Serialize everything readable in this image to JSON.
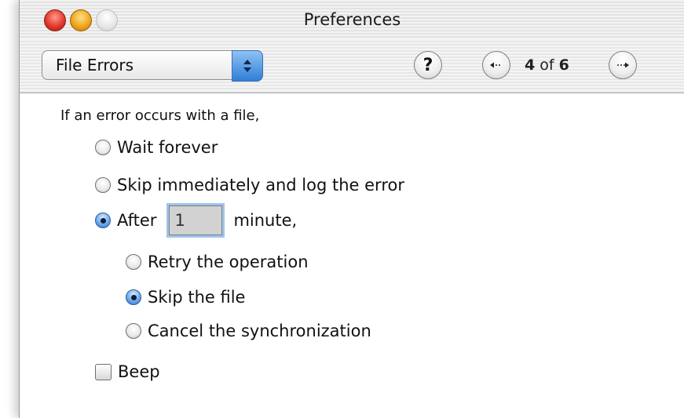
{
  "window": {
    "title": "Preferences"
  },
  "toolbar": {
    "popup_label": "File Errors",
    "help_label": "?",
    "page_current": "4",
    "page_of": "of",
    "page_total": "6"
  },
  "content": {
    "intro": "If an error occurs with a file,",
    "options": {
      "wait_forever": "Wait forever",
      "skip_log": "Skip immediately and log the error",
      "after": "After",
      "after_minutes_value": "1",
      "minute": "minute,"
    },
    "sub_options": {
      "retry": "Retry the operation",
      "skip_file": "Skip the file",
      "cancel_sync": "Cancel the synchronization"
    },
    "beep": "Beep",
    "state": {
      "selected_option": "after",
      "selected_sub_option": "skip_file",
      "beep_checked": false
    }
  },
  "icons": {
    "popup_arrows": "updown-arrows-icon",
    "prev": "left-arrow-icon",
    "next": "right-arrow-icon"
  },
  "colors": {
    "accent_blue": "#2f7fd8",
    "close": "#e23a2b",
    "minimize": "#f2a51d"
  }
}
